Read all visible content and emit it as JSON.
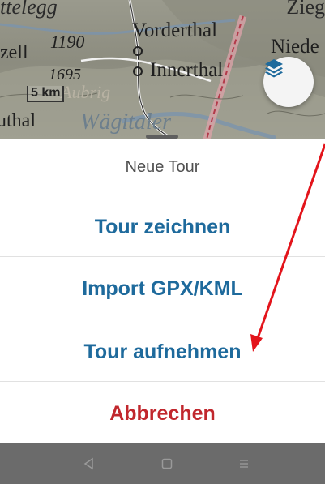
{
  "map": {
    "labels": {
      "top_left": "ttelegg",
      "top_right": "Zieg",
      "vorderthal": "Vorderthal",
      "niede": "Niede",
      "zell": "zell",
      "elev_1190": "1190",
      "elev_1695": "1695",
      "innerthal": "Innerthal",
      "aubrig": "Aubrig",
      "wagitaler": "Wägitaler",
      "luthal": "uthal"
    },
    "scale_label": "5 km",
    "layer_button_icon": "layers-icon"
  },
  "sheet": {
    "title": "Neue Tour",
    "options": [
      {
        "label": "Tour zeichnen"
      },
      {
        "label": "Import GPX/KML"
      },
      {
        "label": "Tour aufnehmen"
      }
    ],
    "cancel_label": "Abbrechen"
  },
  "navbar": {
    "back_icon": "back-triangle-icon",
    "home_icon": "home-square-icon",
    "menu_icon": "menu-lines-icon"
  },
  "colors": {
    "option_blue": "#1e6a9c",
    "cancel_red": "#c1272d",
    "annotation_red": "#e3141b"
  }
}
